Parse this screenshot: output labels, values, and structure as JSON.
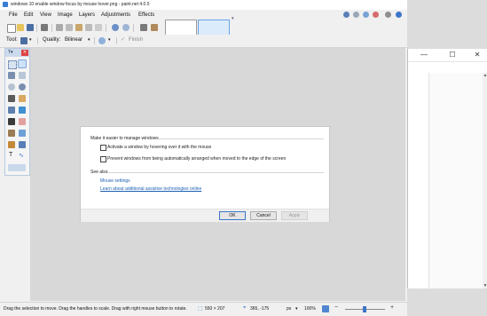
{
  "window": {
    "title": "windows 10 enable window focus by mouse hover.png - paint.net 4.0.5"
  },
  "menu": [
    "File",
    "Edit",
    "View",
    "Image",
    "Layers",
    "Adjustments",
    "Effects"
  ],
  "toolbar2": {
    "tool_label": "Tool:",
    "quality_label": "Quality:",
    "quality_value": "Bilinear",
    "finish_label": "Finish"
  },
  "dialog": {
    "heading": "Make it easier to manage windows",
    "option1": "Activate a window by hovering over it with the mouse",
    "option2": "Prevent windows from being automatically arranged when moved to the edge of the screen",
    "see_also": "See also",
    "link1": "Mouse settings",
    "link2": "Learn about additional assistive technologies online",
    "ok": "OK",
    "cancel": "Cancel",
    "apply": "Apply"
  },
  "status": {
    "hint": "Drag the selection to move. Drag the handles to scale. Drag with right mouse button to rotate.",
    "selection_size": "550 × 207",
    "cursor_pos": "365, -175",
    "units": "px",
    "zoom": "100%"
  },
  "colors": {
    "accent": "#3b74c9",
    "link": "#1a5fb4"
  }
}
